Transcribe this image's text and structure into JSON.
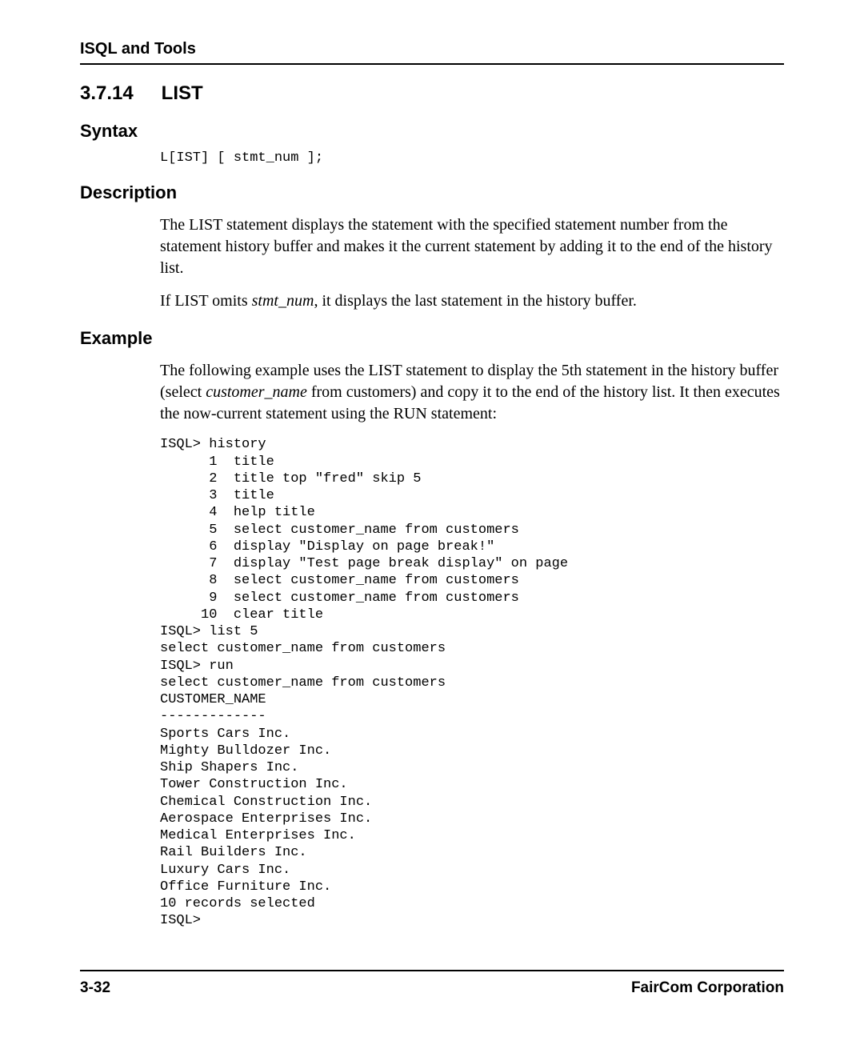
{
  "header": {
    "running": "ISQL and Tools"
  },
  "section": {
    "number": "3.7.14",
    "title": "LIST"
  },
  "syntax": {
    "heading": "Syntax",
    "code": "L[IST] [ stmt_num ];"
  },
  "description": {
    "heading": "Description",
    "para1": "The LIST statement displays the statement with the specified statement number from the statement history buffer and makes it the current statement by adding it to the end of the history list.",
    "para2_pre": "If LIST omits ",
    "para2_em": "stmt_num",
    "para2_post": ", it displays the last statement in the history buffer."
  },
  "example": {
    "heading": "Example",
    "intro_pre": "The following example uses the LIST statement to display the 5th statement in the history buffer (select ",
    "intro_em": "customer_name",
    "intro_post": " from customers) and copy it to the end of the history list. It then executes the now-current statement using the RUN statement:",
    "code": "ISQL> history\n      1  title\n      2  title top \"fred\" skip 5\n      3  title\n      4  help title\n      5  select customer_name from customers\n      6  display \"Display on page break!\"\n      7  display \"Test page break display\" on page\n      8  select customer_name from customers\n      9  select customer_name from customers\n     10  clear title\nISQL> list 5\nselect customer_name from customers\nISQL> run\nselect customer_name from customers\nCUSTOMER_NAME\n-------------\nSports Cars Inc.\nMighty Bulldozer Inc.\nShip Shapers Inc.\nTower Construction Inc.\nChemical Construction Inc.\nAerospace Enterprises Inc.\nMedical Enterprises Inc.\nRail Builders Inc.\nLuxury Cars Inc.\nOffice Furniture Inc.\n10 records selected\nISQL>"
  },
  "footer": {
    "page": "3-32",
    "company": "FairCom Corporation"
  }
}
